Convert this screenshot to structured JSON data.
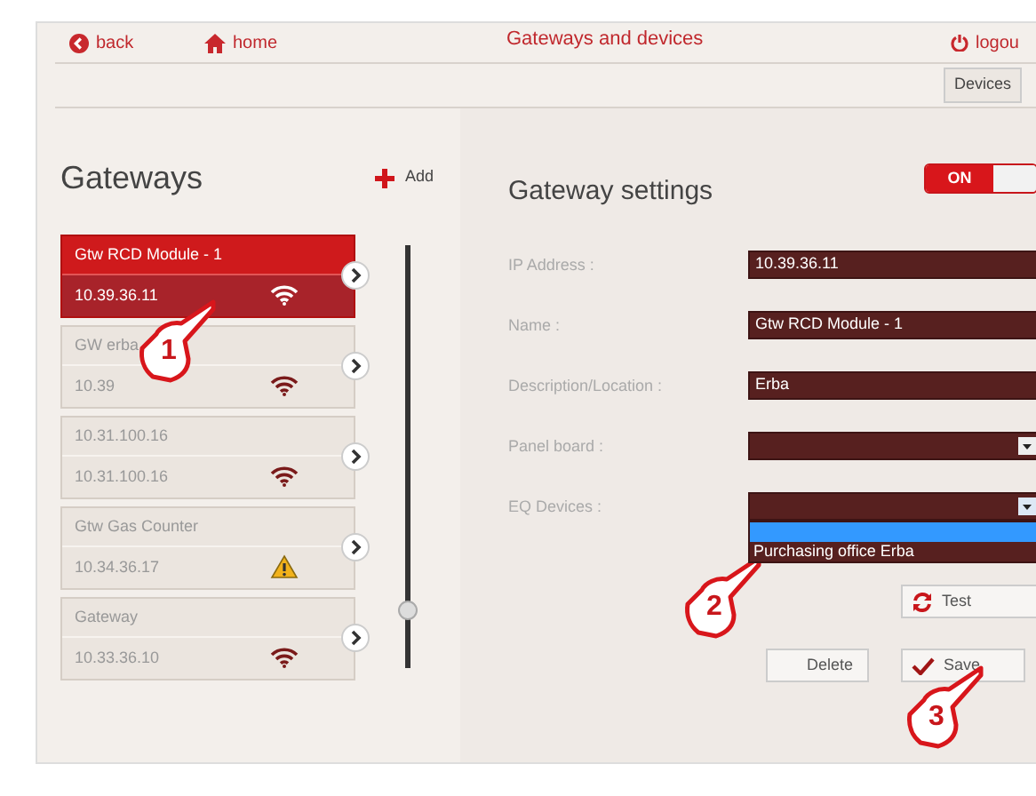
{
  "top_bar": {
    "back": "back",
    "home": "home",
    "title": "Gateways and devices",
    "logout": "logou"
  },
  "breadcrumb": [
    "Devices"
  ],
  "gateways": {
    "title": "Gateways",
    "add": "Add",
    "items": [
      {
        "name": "Gtw RCD Module - 1",
        "ip": "10.39.36.11",
        "kind": "wifi",
        "selected": true
      },
      {
        "name": "GW erba",
        "ip": "10.39",
        "kind": "wifi",
        "selected": false
      },
      {
        "name": "10.31.100.16",
        "ip": "10.31.100.16",
        "kind": "wifi",
        "selected": false
      },
      {
        "name": "Gtw Gas Counter",
        "ip": "10.34.36.17",
        "kind": "warning",
        "selected": false
      },
      {
        "name": "Gateway",
        "ip": "10.33.36.10",
        "kind": "wifi",
        "selected": false
      }
    ]
  },
  "settings": {
    "title": "Gateway settings",
    "toggle": {
      "label": "ON",
      "on": true
    },
    "fields": [
      {
        "label": "IP Address :",
        "kind": "text",
        "value": "10.39.36.11"
      },
      {
        "label": "Name :",
        "kind": "text",
        "value": "Gtw RCD Module - 1"
      },
      {
        "label": "Description/Location :",
        "kind": "text",
        "value": "Erba"
      },
      {
        "label": "Panel board :",
        "kind": "select"
      },
      {
        "label": "EQ Devices :",
        "kind": "select",
        "expanded": true,
        "options": [
          {
            "selected": true
          },
          {
            "label": "Purchasing office Erba",
            "selected": false
          }
        ]
      }
    ],
    "buttons": [
      {
        "label": "Test",
        "kind": "test"
      },
      {
        "label": "Delete",
        "kind": "delete"
      },
      {
        "label": "Save",
        "kind": "save"
      }
    ]
  },
  "callouts": [
    "1",
    "2",
    "3"
  ]
}
